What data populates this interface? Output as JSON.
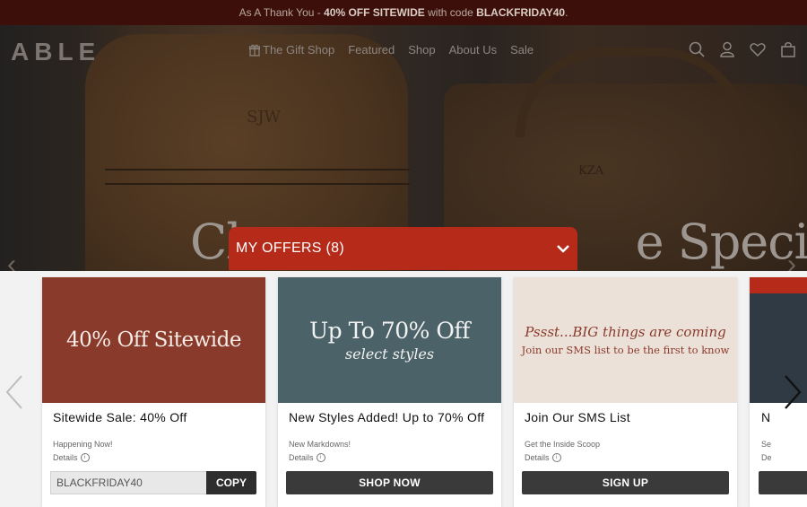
{
  "promo": {
    "prefix": "As A Thank You - ",
    "highlight": "40% OFF SITEWIDE",
    "middle": " with code ",
    "code": "BLACKFRIDAY40",
    "suffix": "."
  },
  "brand": {
    "logo": "ABLE"
  },
  "nav": {
    "items": [
      {
        "label": "The Gift Shop",
        "icon": "gift-icon"
      },
      {
        "label": "Featured"
      },
      {
        "label": "Shop"
      },
      {
        "label": "About Us"
      },
      {
        "label": "Sale"
      }
    ],
    "icons": [
      "search-icon",
      "user-icon",
      "heart-icon",
      "shopping-bag-icon"
    ]
  },
  "hero": {
    "heading_left": "Cl",
    "heading_right": "e Special",
    "monogram_left": "SJW",
    "monogram_right": "KZA"
  },
  "offers": {
    "title": "MY OFFERS (8)",
    "cards": [
      {
        "image_text": "40% Off Sitewide",
        "image_bg": "#8a3a2a",
        "title": "Sitewide Sale: 40% Off",
        "subtitle": "Happening Now!",
        "details": "Details",
        "code": "BLACKFRIDAY40",
        "button": "COPY"
      },
      {
        "image_text": "Up To 70% Off",
        "image_subtext": "select styles",
        "image_bg": "#4b6269",
        "title": "New Styles Added! Up to 70% Off",
        "subtitle": "New Markdowns!",
        "details": "Details",
        "button": "SHOP NOW"
      },
      {
        "image_text": "Pssst...BIG things are coming",
        "image_subtext": "Join our SMS list to be the first to know",
        "image_bg": "#ebe1d8",
        "title": "Join Our SMS List",
        "subtitle": "Get the Inside Scoop",
        "details": "Details",
        "button": "SIGN UP"
      },
      {
        "title": "N",
        "subtitle": "Se",
        "details": "De"
      }
    ]
  },
  "colors": {
    "promo_bg": "#3d0f0a",
    "offers_tab": "#b52a19",
    "button_dark": "#3a3a3a"
  }
}
